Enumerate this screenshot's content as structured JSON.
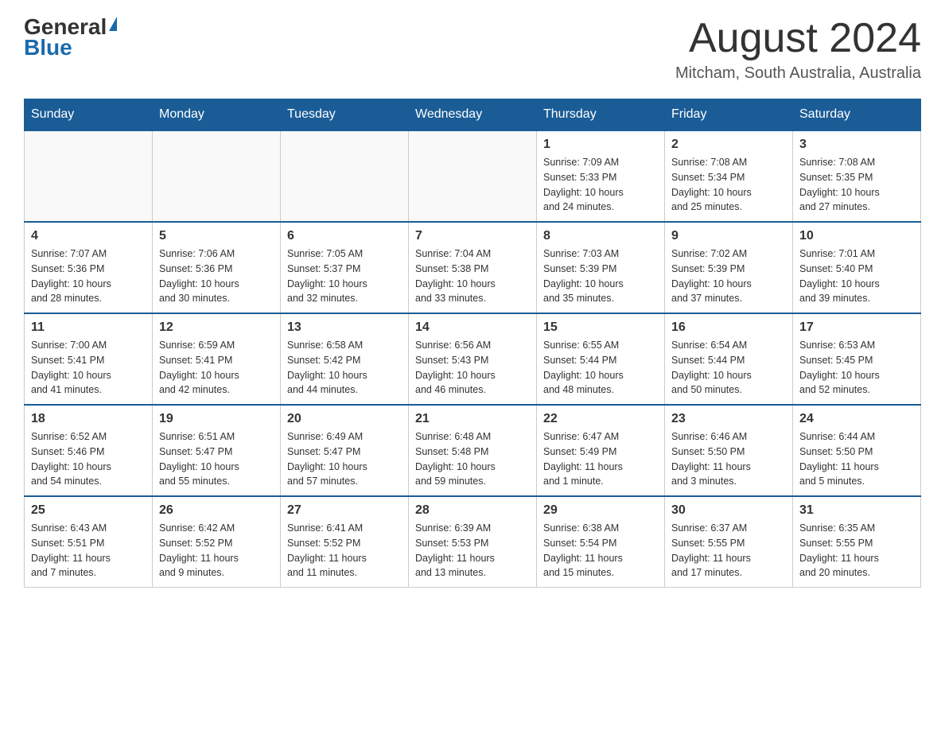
{
  "header": {
    "logo_general": "General",
    "logo_blue": "Blue",
    "month_title": "August 2024",
    "location": "Mitcham, South Australia, Australia"
  },
  "days_of_week": [
    "Sunday",
    "Monday",
    "Tuesday",
    "Wednesday",
    "Thursday",
    "Friday",
    "Saturday"
  ],
  "weeks": [
    [
      {
        "day": "",
        "info": ""
      },
      {
        "day": "",
        "info": ""
      },
      {
        "day": "",
        "info": ""
      },
      {
        "day": "",
        "info": ""
      },
      {
        "day": "1",
        "info": "Sunrise: 7:09 AM\nSunset: 5:33 PM\nDaylight: 10 hours\nand 24 minutes."
      },
      {
        "day": "2",
        "info": "Sunrise: 7:08 AM\nSunset: 5:34 PM\nDaylight: 10 hours\nand 25 minutes."
      },
      {
        "day": "3",
        "info": "Sunrise: 7:08 AM\nSunset: 5:35 PM\nDaylight: 10 hours\nand 27 minutes."
      }
    ],
    [
      {
        "day": "4",
        "info": "Sunrise: 7:07 AM\nSunset: 5:36 PM\nDaylight: 10 hours\nand 28 minutes."
      },
      {
        "day": "5",
        "info": "Sunrise: 7:06 AM\nSunset: 5:36 PM\nDaylight: 10 hours\nand 30 minutes."
      },
      {
        "day": "6",
        "info": "Sunrise: 7:05 AM\nSunset: 5:37 PM\nDaylight: 10 hours\nand 32 minutes."
      },
      {
        "day": "7",
        "info": "Sunrise: 7:04 AM\nSunset: 5:38 PM\nDaylight: 10 hours\nand 33 minutes."
      },
      {
        "day": "8",
        "info": "Sunrise: 7:03 AM\nSunset: 5:39 PM\nDaylight: 10 hours\nand 35 minutes."
      },
      {
        "day": "9",
        "info": "Sunrise: 7:02 AM\nSunset: 5:39 PM\nDaylight: 10 hours\nand 37 minutes."
      },
      {
        "day": "10",
        "info": "Sunrise: 7:01 AM\nSunset: 5:40 PM\nDaylight: 10 hours\nand 39 minutes."
      }
    ],
    [
      {
        "day": "11",
        "info": "Sunrise: 7:00 AM\nSunset: 5:41 PM\nDaylight: 10 hours\nand 41 minutes."
      },
      {
        "day": "12",
        "info": "Sunrise: 6:59 AM\nSunset: 5:41 PM\nDaylight: 10 hours\nand 42 minutes."
      },
      {
        "day": "13",
        "info": "Sunrise: 6:58 AM\nSunset: 5:42 PM\nDaylight: 10 hours\nand 44 minutes."
      },
      {
        "day": "14",
        "info": "Sunrise: 6:56 AM\nSunset: 5:43 PM\nDaylight: 10 hours\nand 46 minutes."
      },
      {
        "day": "15",
        "info": "Sunrise: 6:55 AM\nSunset: 5:44 PM\nDaylight: 10 hours\nand 48 minutes."
      },
      {
        "day": "16",
        "info": "Sunrise: 6:54 AM\nSunset: 5:44 PM\nDaylight: 10 hours\nand 50 minutes."
      },
      {
        "day": "17",
        "info": "Sunrise: 6:53 AM\nSunset: 5:45 PM\nDaylight: 10 hours\nand 52 minutes."
      }
    ],
    [
      {
        "day": "18",
        "info": "Sunrise: 6:52 AM\nSunset: 5:46 PM\nDaylight: 10 hours\nand 54 minutes."
      },
      {
        "day": "19",
        "info": "Sunrise: 6:51 AM\nSunset: 5:47 PM\nDaylight: 10 hours\nand 55 minutes."
      },
      {
        "day": "20",
        "info": "Sunrise: 6:49 AM\nSunset: 5:47 PM\nDaylight: 10 hours\nand 57 minutes."
      },
      {
        "day": "21",
        "info": "Sunrise: 6:48 AM\nSunset: 5:48 PM\nDaylight: 10 hours\nand 59 minutes."
      },
      {
        "day": "22",
        "info": "Sunrise: 6:47 AM\nSunset: 5:49 PM\nDaylight: 11 hours\nand 1 minute."
      },
      {
        "day": "23",
        "info": "Sunrise: 6:46 AM\nSunset: 5:50 PM\nDaylight: 11 hours\nand 3 minutes."
      },
      {
        "day": "24",
        "info": "Sunrise: 6:44 AM\nSunset: 5:50 PM\nDaylight: 11 hours\nand 5 minutes."
      }
    ],
    [
      {
        "day": "25",
        "info": "Sunrise: 6:43 AM\nSunset: 5:51 PM\nDaylight: 11 hours\nand 7 minutes."
      },
      {
        "day": "26",
        "info": "Sunrise: 6:42 AM\nSunset: 5:52 PM\nDaylight: 11 hours\nand 9 minutes."
      },
      {
        "day": "27",
        "info": "Sunrise: 6:41 AM\nSunset: 5:52 PM\nDaylight: 11 hours\nand 11 minutes."
      },
      {
        "day": "28",
        "info": "Sunrise: 6:39 AM\nSunset: 5:53 PM\nDaylight: 11 hours\nand 13 minutes."
      },
      {
        "day": "29",
        "info": "Sunrise: 6:38 AM\nSunset: 5:54 PM\nDaylight: 11 hours\nand 15 minutes."
      },
      {
        "day": "30",
        "info": "Sunrise: 6:37 AM\nSunset: 5:55 PM\nDaylight: 11 hours\nand 17 minutes."
      },
      {
        "day": "31",
        "info": "Sunrise: 6:35 AM\nSunset: 5:55 PM\nDaylight: 11 hours\nand 20 minutes."
      }
    ]
  ]
}
